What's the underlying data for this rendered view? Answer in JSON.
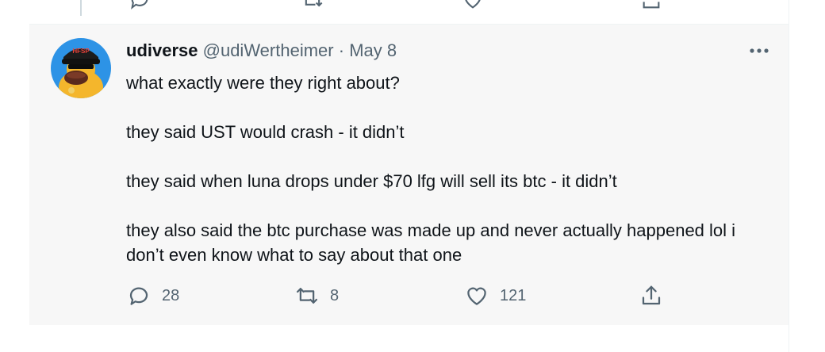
{
  "tweet": {
    "author_name": "udiverse",
    "handle": "@udiWertheimer",
    "separator": "·",
    "date": "May 8",
    "paragraphs": [
      "what exactly were they right about?",
      "they said UST would crash - it didn’t",
      "they said when luna drops under $70 lfg will sell its btc - it didn’t",
      "they also said the btc purchase was made up and never actually happened lol i don’t even know what to say about that one"
    ],
    "actions": {
      "reply_count": "28",
      "retweet_count": "8",
      "like_count": "121"
    },
    "icons": {
      "reply": "reply-icon",
      "retweet": "retweet-icon",
      "like": "heart-icon",
      "share": "share-icon",
      "more": "more-options-icon"
    },
    "avatar_cap_text": "HFSP"
  },
  "colors": {
    "text_primary": "#0f1419",
    "text_secondary": "#536471",
    "accent": "#1d9bf0",
    "tweet_background": "#f7f7f7",
    "avatar_background": "#2d93e6"
  }
}
